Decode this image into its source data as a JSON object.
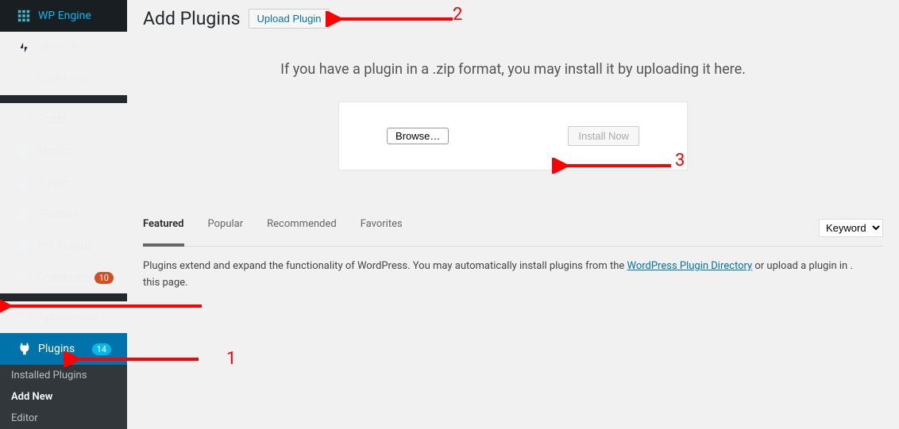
{
  "sidebar": {
    "items": [
      {
        "label": "WP Engine",
        "icon": "grid"
      },
      {
        "label": "Jetpack",
        "icon": "jetpack"
      },
      {
        "label": "Dashboard",
        "icon": "dashboard"
      },
      {
        "label": "Posts",
        "icon": "pin"
      },
      {
        "label": "Media",
        "icon": "media"
      },
      {
        "label": "Pages",
        "icon": "pages"
      },
      {
        "label": "Themes",
        "icon": "themes"
      },
      {
        "label": "Flo Plugins",
        "icon": "flo"
      },
      {
        "label": "Comments",
        "icon": "comments",
        "badge": "10",
        "badge_color": "orange"
      },
      {
        "label": "Appearance",
        "icon": "appearance"
      },
      {
        "label": "Plugins",
        "icon": "plugins",
        "badge": "14",
        "badge_color": "blue",
        "active": true
      }
    ],
    "submenu": [
      {
        "label": "Installed Plugins"
      },
      {
        "label": "Add New",
        "active": true
      },
      {
        "label": "Editor"
      }
    ]
  },
  "header": {
    "title": "Add Plugins",
    "upload_button": "Upload Plugin"
  },
  "upload": {
    "instruction": "If you have a plugin in a .zip format, you may install it by uploading it here.",
    "browse_button": "Browse…",
    "install_button": "Install Now"
  },
  "tabs": [
    {
      "label": "Featured",
      "active": true
    },
    {
      "label": "Popular"
    },
    {
      "label": "Recommended"
    },
    {
      "label": "Favorites"
    }
  ],
  "search": {
    "keyword_label": "Keyword"
  },
  "description": {
    "text_before": "Plugins extend and expand the functionality of WordPress. You may automatically install plugins from the ",
    "link": "WordPress Plugin Directory",
    "text_after": " or upload a plugin in .",
    "text_line2": "this page."
  },
  "annotations": {
    "n1": "1",
    "n2": "2",
    "n3": "3"
  }
}
